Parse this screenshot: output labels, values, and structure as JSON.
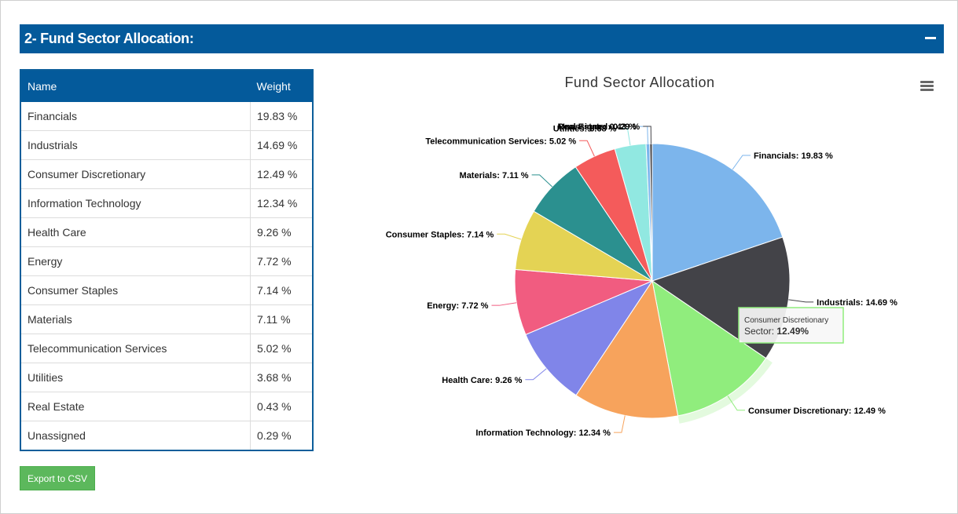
{
  "section": {
    "title": "2- Fund Sector Allocation:"
  },
  "table": {
    "headers": {
      "name": "Name",
      "weight": "Weight"
    },
    "rows": [
      {
        "name": "Financials",
        "weight": "19.83 %"
      },
      {
        "name": "Industrials",
        "weight": "14.69 %"
      },
      {
        "name": "Consumer Discretionary",
        "weight": "12.49 %"
      },
      {
        "name": "Information Technology",
        "weight": "12.34 %"
      },
      {
        "name": "Health Care",
        "weight": "9.26 %"
      },
      {
        "name": "Energy",
        "weight": "7.72 %"
      },
      {
        "name": "Consumer Staples",
        "weight": "7.14 %"
      },
      {
        "name": "Materials",
        "weight": "7.11 %"
      },
      {
        "name": "Telecommunication Services",
        "weight": "5.02 %"
      },
      {
        "name": "Utilities",
        "weight": "3.68 %"
      },
      {
        "name": "Real Estate",
        "weight": "0.43 %"
      },
      {
        "name": "Unassigned",
        "weight": "0.29 %"
      }
    ]
  },
  "export_button": {
    "label": "Export to CSV"
  },
  "chart_menu": {
    "icon": "hamburger-menu-icon"
  },
  "chart_data": {
    "type": "pie",
    "title": "Fund Sector Allocation",
    "slices": [
      {
        "name": "Financials",
        "value": 19.83,
        "label": "Financials: 19.83 %",
        "color": "#7cb5ec"
      },
      {
        "name": "Industrials",
        "value": 14.69,
        "label": "Industrials: 14.69 %",
        "color": "#434348"
      },
      {
        "name": "Consumer Discretionary",
        "value": 12.49,
        "label": "Consumer Discretionary: 12.49 %",
        "color": "#90ed7d"
      },
      {
        "name": "Information Technology",
        "value": 12.34,
        "label": "Information Technology: 12.34 %",
        "color": "#f7a35c"
      },
      {
        "name": "Health Care",
        "value": 9.26,
        "label": "Health Care: 9.26 %",
        "color": "#8085e9"
      },
      {
        "name": "Energy",
        "value": 7.72,
        "label": "Energy: 7.72 %",
        "color": "#f15c80"
      },
      {
        "name": "Consumer Staples",
        "value": 7.14,
        "label": "Consumer Staples: 7.14 %",
        "color": "#e4d354"
      },
      {
        "name": "Materials",
        "value": 7.11,
        "label": "Materials: 7.11 %",
        "color": "#2b908f"
      },
      {
        "name": "Telecommunication Services",
        "value": 5.02,
        "label": "Telecommunication Services: 5.02 %",
        "color": "#f45b5b"
      },
      {
        "name": "Utilities",
        "value": 3.68,
        "label": "Utilities: 3.68 %",
        "color": "#91e8e1"
      },
      {
        "name": "Real Estate",
        "value": 0.43,
        "label": "Real Estate: 0.43 %",
        "color": "#7cb5ec"
      },
      {
        "name": "Unassigned",
        "value": 0.29,
        "label": "Unassigned: 0.29 %",
        "color": "#434348"
      }
    ],
    "highlighted": "Consumer Discretionary",
    "tooltip": {
      "title": "Consumer Discretionary",
      "series": "Sector",
      "value": "12.49%"
    }
  }
}
